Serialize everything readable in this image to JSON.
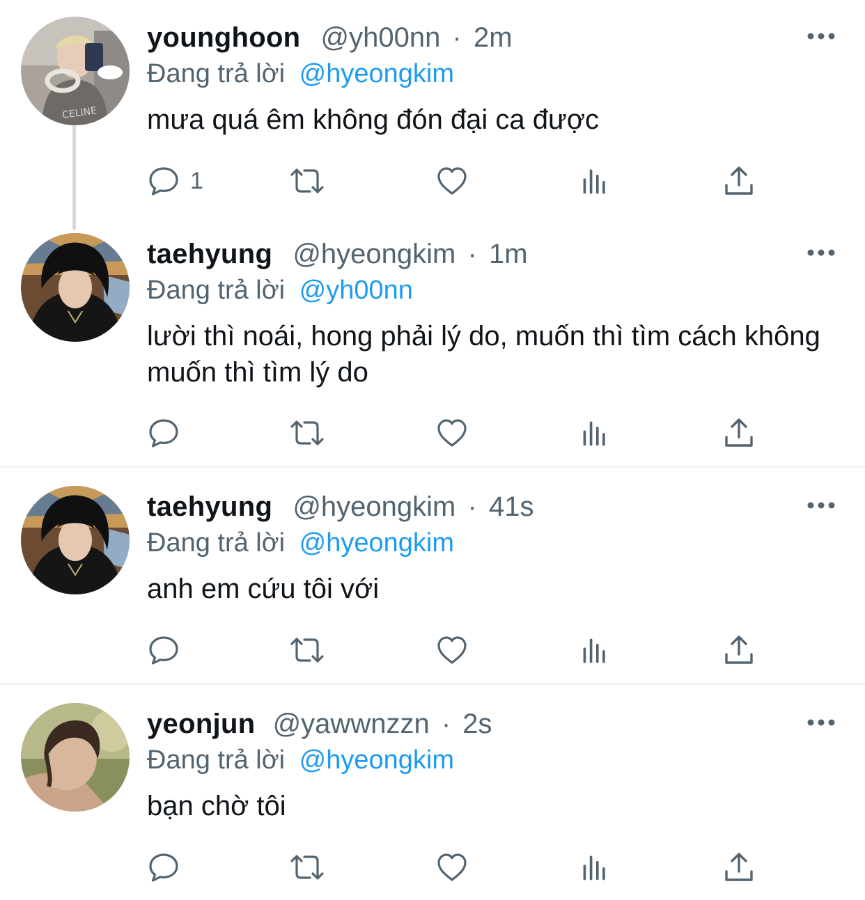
{
  "labels": {
    "replying_to": "Đang trả lời"
  },
  "tweets": [
    {
      "name": "younghoon",
      "handle": "@yh00nn",
      "separator": "·",
      "time": "2m",
      "reply_to": "@hyeongkim",
      "text": "mưa quá êm không đón đại ca được",
      "reply_count": "1"
    },
    {
      "name": "taehyung",
      "handle": "@hyeongkim",
      "separator": "·",
      "time": "1m",
      "reply_to": "@yh00nn",
      "text": "lười thì noái, hong phải lý do, muốn thì tìm cách không muốn thì tìm lý do",
      "reply_count": ""
    },
    {
      "name": "taehyung",
      "handle": "@hyeongkim",
      "separator": "·",
      "time": "41s",
      "reply_to": "@hyeongkim",
      "text": "anh em cứu tôi với",
      "reply_count": ""
    },
    {
      "name": "yeonjun",
      "handle": "@yawwnzzn",
      "separator": "·",
      "time": "2s",
      "reply_to": "@hyeongkim",
      "text": "bạn chờ tôi",
      "reply_count": ""
    }
  ],
  "icons": {
    "reply": "reply-icon",
    "retweet": "retweet-icon",
    "like": "heart-icon",
    "views": "views-icon",
    "share": "share-icon",
    "more": "more-icon"
  },
  "colors": {
    "text": "#0f1419",
    "secondary": "#536471",
    "accent": "#1d9bf0",
    "divider": "#eff3f4",
    "thread_line": "#cfd9de"
  }
}
